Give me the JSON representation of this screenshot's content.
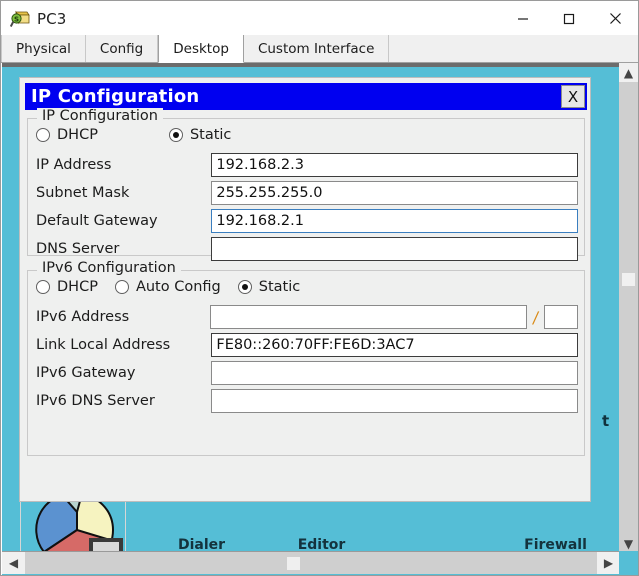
{
  "window": {
    "title": "PC3",
    "icon": "packet-tracer-device-icon",
    "controls": {
      "minimize": "minimize-icon",
      "maximize": "maximize-icon",
      "close": "close-icon"
    }
  },
  "tabs": [
    {
      "label": "Physical",
      "active": false
    },
    {
      "label": "Config",
      "active": false
    },
    {
      "label": "Desktop",
      "active": true
    },
    {
      "label": "Custom Interface",
      "active": false
    }
  ],
  "dialog": {
    "title": "IP Configuration",
    "close_label": "X",
    "ipv4": {
      "legend": "IP Configuration",
      "mode_options": [
        "DHCP",
        "Static"
      ],
      "mode_selected": "Static",
      "fields": [
        {
          "label": "IP Address",
          "value": "192.168.2.3",
          "focused": false,
          "border": "dark"
        },
        {
          "label": "Subnet Mask",
          "value": "255.255.255.0",
          "focused": false,
          "border": "soft"
        },
        {
          "label": "Default Gateway",
          "value": "192.168.2.1",
          "focused": true,
          "border": "focus"
        },
        {
          "label": "DNS Server",
          "value": "",
          "focused": false,
          "border": "dark"
        }
      ]
    },
    "ipv6": {
      "legend": "IPv6 Configuration",
      "mode_options": [
        "DHCP",
        "Auto Config",
        "Static"
      ],
      "mode_selected": "Static",
      "address_label": "IPv6 Address",
      "address_value": "",
      "prefix_separator": "/",
      "prefix_value": "",
      "fields": [
        {
          "label": "Link Local Address",
          "value": "FE80::260:70FF:FE6D:3AC7",
          "border": "dark"
        },
        {
          "label": "IPv6 Gateway",
          "value": "",
          "border": "soft"
        },
        {
          "label": "IPv6 DNS Server",
          "value": "",
          "border": "soft"
        }
      ]
    }
  },
  "desktop_background": {
    "icons": [
      {
        "label": "Dialer",
        "icon": "dialer-icon"
      },
      {
        "label": "Editor",
        "icon": "text-editor-icon"
      },
      {
        "label": "Firewall",
        "icon": "firewall-icon"
      }
    ],
    "bottom_icon": "traffic-generator-pie-icon",
    "edge_fragment": "t"
  },
  "scrollbars": {
    "vertical": {
      "up": "chevron-up-icon",
      "down": "chevron-down-icon"
    },
    "horizontal": {
      "left": "chevron-left-icon",
      "right": "chevron-right-icon"
    }
  },
  "colors": {
    "desktop_teal": "#55BED6",
    "dialog_titlebar": "#0000F0",
    "dialog_face": "#EFF0EF",
    "focus_border": "#3A7EBF",
    "slash": "#D98A16"
  }
}
